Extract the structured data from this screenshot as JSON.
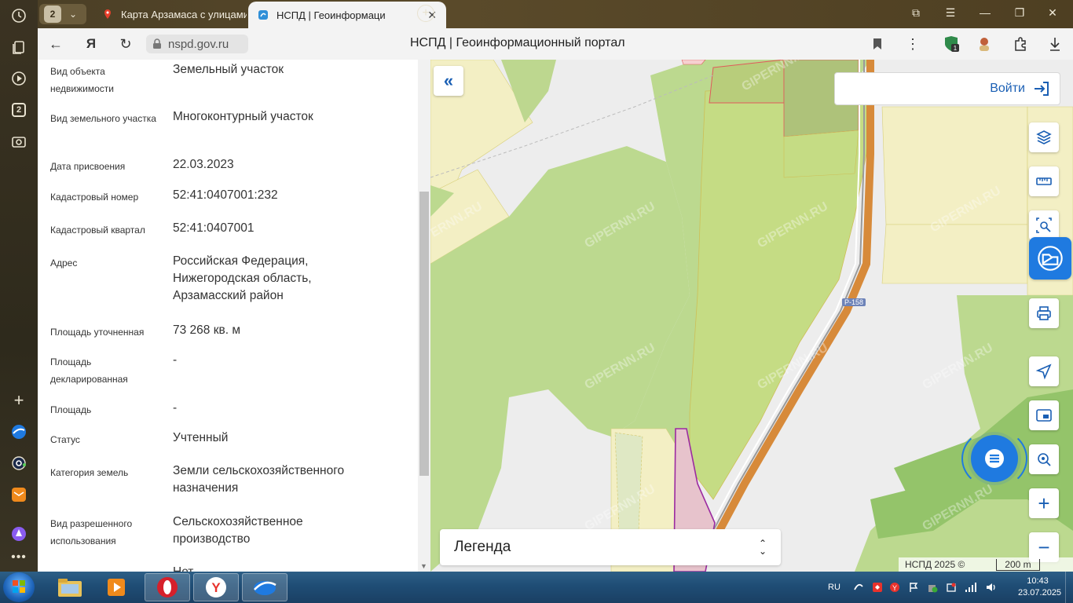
{
  "browser": {
    "tab_count": "2",
    "tabs": [
      {
        "title": "Карта Арзамаса с улицами"
      },
      {
        "title": "НСПД | Геоинформаци"
      }
    ],
    "url": "nspd.gov.ru",
    "page_title": "НСПД | Геоинформационный портал",
    "extension_badge": "1",
    "side_tab_badge": "2"
  },
  "panel": {
    "rows": [
      {
        "label": "Вид объекта недвижимости",
        "value": "Земельный участок"
      },
      {
        "label": "Вид земельного участка",
        "value": "Многоконтурный участок"
      },
      {
        "label": "Дата присвоения",
        "value": "22.03.2023"
      },
      {
        "label": "Кадастровый номер",
        "value": "52:41:0407001:232"
      },
      {
        "label": "Кадастровый квартал",
        "value": "52:41:0407001"
      },
      {
        "label": "Адрес",
        "value": "Российская Федерация, Нижегородская область, Арзамасский район"
      },
      {
        "label": "Площадь уточненная",
        "value": "73 268 кв. м"
      },
      {
        "label": "Площадь декларированная",
        "value": "-"
      },
      {
        "label": "Площадь",
        "value": "-"
      },
      {
        "label": "Статус",
        "value": "Учтенный"
      },
      {
        "label": "Категория земель",
        "value": "Земли сельскохозяйственного назначения"
      },
      {
        "label": "Вид разрешенного использования",
        "value": "Сельскохозяйственное производство"
      },
      {
        "label": "",
        "value": "Нет"
      }
    ]
  },
  "map": {
    "login_label": "Войти",
    "legend_label": "Легенда",
    "attribution": "НСПД 2025 ©",
    "scale_label": "200 m",
    "road_label": "Р-158",
    "watermark": "GIPERNN.RU",
    "colors": {
      "accent": "#1a5fb4",
      "forest": "#bcd98f",
      "field": "#f4f0c3",
      "parcel": "#e7c3cc",
      "road": "#d78a3a"
    }
  },
  "taskbar": {
    "language": "RU",
    "time": "10:43",
    "date": "23.07.2025"
  }
}
